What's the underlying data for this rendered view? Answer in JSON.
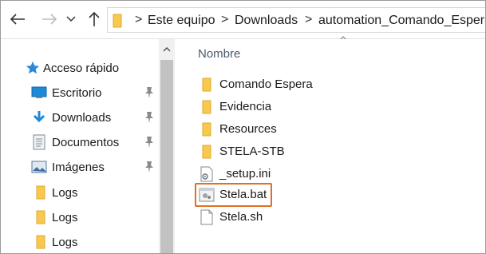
{
  "toolbar": {
    "back_icon": "back-arrow-icon",
    "forward_icon": "forward-arrow-icon",
    "recent_icon": "chevron-down-icon",
    "up_icon": "up-arrow-icon"
  },
  "breadcrumb": {
    "items": [
      "Este equipo",
      "Downloads",
      "automation_Comando_Espera"
    ],
    "separator": ">"
  },
  "sidebar": {
    "quick_access": "Acceso rápido",
    "items": [
      {
        "label": "Escritorio",
        "icon": "desktop-icon",
        "pinned": true
      },
      {
        "label": "Downloads",
        "icon": "download-arrow-icon",
        "pinned": true
      },
      {
        "label": "Documentos",
        "icon": "documents-icon",
        "pinned": true
      },
      {
        "label": "Imágenes",
        "icon": "pictures-icon",
        "pinned": true
      },
      {
        "label": "Logs",
        "icon": "folder-icon",
        "pinned": false
      },
      {
        "label": "Logs",
        "icon": "folder-icon",
        "pinned": false
      },
      {
        "label": "Logs",
        "icon": "folder-icon",
        "pinned": false
      }
    ]
  },
  "content": {
    "column_name": "Nombre",
    "files": [
      {
        "name": "Comando Espera",
        "type": "folder"
      },
      {
        "name": "Evidencia",
        "type": "folder"
      },
      {
        "name": "Resources",
        "type": "folder"
      },
      {
        "name": "STELA-STB",
        "type": "folder"
      },
      {
        "name": "_setup.ini",
        "type": "ini"
      },
      {
        "name": "Stela.bat",
        "type": "bat",
        "highlighted": true
      },
      {
        "name": "Stela.sh",
        "type": "file"
      }
    ]
  },
  "colors": {
    "folder": "#f8c94e",
    "highlight_border": "#e06f24",
    "accent_blue": "#1e88d9"
  }
}
